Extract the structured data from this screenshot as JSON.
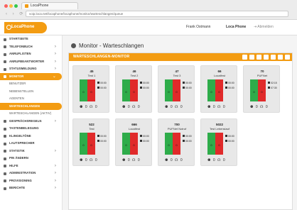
{
  "browser": {
    "tab_title": "LocaPhone",
    "url": "voip.loca.net/locaphone/locaphone/monitor/warteschlangen/queue",
    "nav": "‹ › ⟳"
  },
  "header": {
    "logo": "LocaPhone",
    "user": "Frank Ostmann",
    "company": "Loca Phone",
    "actions": "⇥  Abmelden"
  },
  "sidebar": {
    "items": [
      {
        "label": "STARTSEITE"
      },
      {
        "label": "TELEFONBUCH",
        "chevron": "›"
      },
      {
        "label": "ANRUFLISTEN",
        "chevron": "›"
      },
      {
        "label": "ANRUFBEANTWORTER",
        "chevron": "›"
      },
      {
        "label": "STATUSMELDUNG",
        "chevron": "›"
      },
      {
        "label": "MONITOR",
        "chevron": "⌄"
      },
      {
        "label": "BENUTZER"
      },
      {
        "label": "NEBENSTELLEN"
      },
      {
        "label": "AGENTEN"
      },
      {
        "label": "WARTESCHLANGEN"
      },
      {
        "label": "WARTESCHLANGEN (AKTIV)"
      },
      {
        "label": "GESPRÄCHSREGELN",
        "chevron": "›"
      },
      {
        "label": "TASTENBELEGUNG"
      },
      {
        "label": "KLINGELTÖNE"
      },
      {
        "label": "LAUTSPRECHER"
      },
      {
        "label": "STATISTIK",
        "chevron": "›"
      },
      {
        "label": "PIN ÄNDERN"
      },
      {
        "label": "HILFE",
        "chevron": "›"
      },
      {
        "label": "ADMINISTRATION",
        "chevron": "›"
      },
      {
        "label": "PROVISIONING",
        "chevron": "›"
      },
      {
        "label": "BERICHTE",
        "chevron": "›"
      }
    ]
  },
  "page": {
    "title": "Monitor - Warteschlangen",
    "panel_title": "WARTESCHLANGEN-MONITOR",
    "toolbar": [
      "⛶",
      "⚙",
      "↻",
      "◉",
      "▾",
      "✕",
      "⊖"
    ]
  },
  "queues": [
    {
      "number": "45",
      "name": "Test 1",
      "green": "0",
      "red": "0",
      "t1": "00:00",
      "t2": "00:00",
      "footer": "⚉ 0 ☊ 0"
    },
    {
      "number": "46",
      "name": "Test 2",
      "green": "0",
      "red": "0",
      "t1": "00:00",
      "t2": "00:00",
      "footer": "⚉ 0 ☊ 0"
    },
    {
      "number": "47",
      "name": "Test 3",
      "green": "0",
      "red": "0",
      "t1": "00:00",
      "t2": "00:00",
      "footer": "⚉ 0 ☊ 0"
    },
    {
      "number": "66",
      "name": "Localfest",
      "green": "0",
      "red": "0",
      "t1": "00:00",
      "t2": "00:00",
      "footer": "⚉ 0 ☊ 0"
    },
    {
      "number": "70",
      "name": "PUFNet",
      "green": "0",
      "red": "0",
      "t1": "02:15",
      "t2": "07:30",
      "footer": "⚉ 0 ☊ 0"
    },
    {
      "number": "522",
      "name": "Test",
      "green": "0",
      "red": "0",
      "t1": "00:00",
      "t2": "00:00",
      "footer": "⚉ 0 ☊ 0"
    },
    {
      "number": "666",
      "name": "Localfest",
      "green": "0",
      "red": "0",
      "t1": "00:00",
      "t2": "00:00",
      "footer": "⚉ 0 ☊ 0"
    },
    {
      "number": "700",
      "name": "PUFNet Notruf",
      "green": "0",
      "red": "0",
      "t1": "00:00",
      "t2": "00:00",
      "footer": "⚉ 0 ☊ 0"
    },
    {
      "number": "5022",
      "name": "Test Lebenslauf",
      "green": "0",
      "red": "0",
      "t1": "00:00",
      "t2": "00:00",
      "footer": "⚉ 0 ☊ 0"
    }
  ],
  "colors": {
    "accent": "#f39c12",
    "green": "#2eac4a",
    "red": "#e02a2a"
  },
  "icons": [
    "close-dot",
    "minimize-dot",
    "maximize-dot",
    "phone-logo-icon",
    "monitor-icon",
    "timer-icon",
    "agent-icon",
    "headset-icon"
  ]
}
